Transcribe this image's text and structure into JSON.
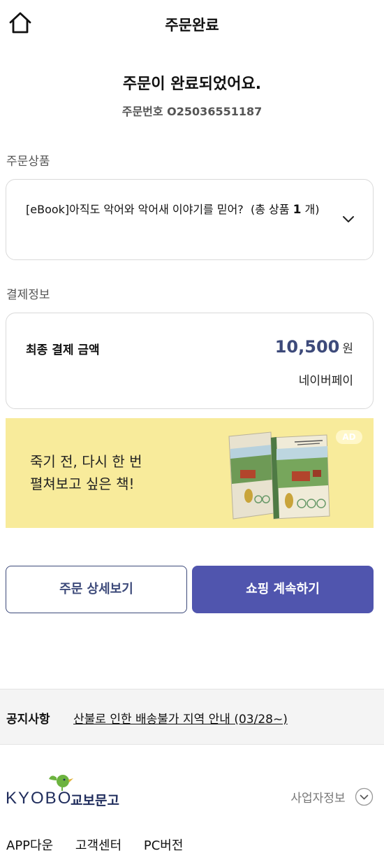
{
  "header": {
    "title": "주문완료"
  },
  "complete": {
    "title": "주문이 완료되었어요.",
    "order_number": "주문번호 O25036551187"
  },
  "products": {
    "section_label": "주문상품",
    "item_title": "[eBook]아직도 악어와 악어새 이야기를 믿어?",
    "count_prefix": "(총 상품",
    "count": "1",
    "count_suffix": "개)"
  },
  "payment": {
    "section_label": "결제정보",
    "final_label": "최종 결제 금액",
    "amount": "10,500",
    "currency": "원",
    "method": "네이버페이"
  },
  "ad": {
    "line1": "죽기 전, 다시 한 번",
    "line2": "펼쳐보고 싶은 책!",
    "badge": "AD",
    "bg_color": "#f8eb9b"
  },
  "buttons": {
    "detail": "주문 상세보기",
    "continue": "쇼핑 계속하기",
    "primary_color": "#5055ae"
  },
  "notice": {
    "label": "공지사항",
    "link": "산불로 인한 배송불가 지역 안내 (03/28~)"
  },
  "footer": {
    "logo_text": "KYOBO",
    "logo_kr": "교보문고",
    "biz_info": "사업자정보",
    "links": [
      "APP다운",
      "고객센터",
      "PC버전"
    ]
  },
  "icons": {
    "home": "home-icon",
    "chevron": "chevron-down-icon",
    "circle_chevron": "circle-chevron-down-icon"
  }
}
